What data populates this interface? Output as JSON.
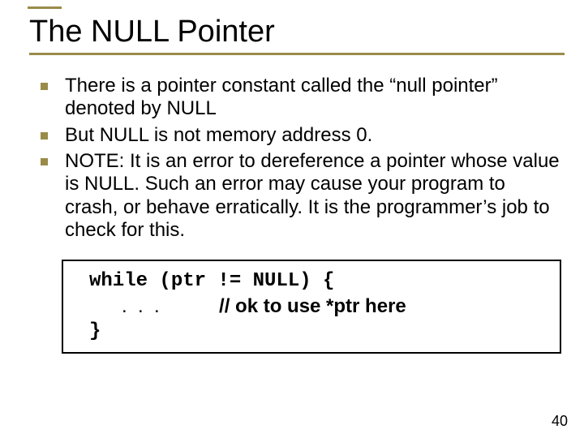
{
  "title": "The  NULL Pointer",
  "bullets_group1": [
    "There is a pointer constant called the “null pointer” denoted by NULL",
    "But NULL is not memory address 0."
  ],
  "bullets_group2": [
    "NOTE:  It is an error to dereference a pointer whose value is NULL.  Such an error may cause your program to crash, or behave erratically.   It is the programmer’s job to check for this."
  ],
  "code": {
    "line1": "while (ptr != NULL) {",
    "line2_dots": "      .  .  .           ",
    "line2_comment": "// ok to use *ptr here",
    "line3": "}"
  },
  "page_number": "40"
}
